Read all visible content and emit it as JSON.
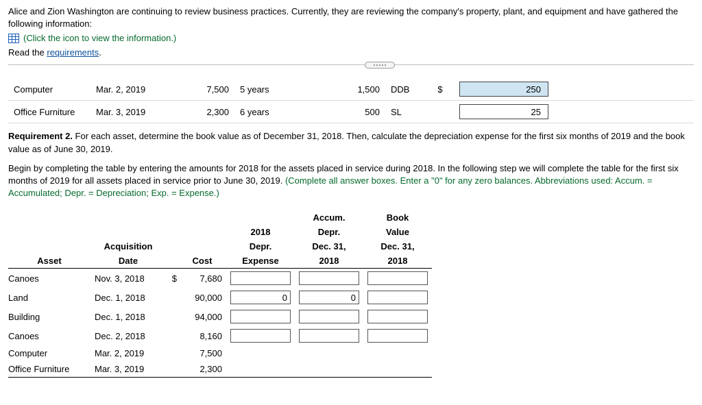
{
  "intro": "Alice and Zion Washington are continuing to review business practices. Currently, they are reviewing the company's property, plant, and equipment and have gathered the following information:",
  "infoLink": "(Click the icon to view the information.)",
  "readReq": {
    "prefix": "Read the ",
    "link": "requirements",
    "suffix": "."
  },
  "upperRows": [
    {
      "asset": "Computer",
      "date": "Mar. 2, 2019",
      "cost": "7,500",
      "life": "5 years",
      "residual": "1,500",
      "method": "DDB",
      "dollar": "$",
      "expense": "250",
      "highlight": true
    },
    {
      "asset": "Office Furniture",
      "date": "Mar. 3, 2019",
      "cost": "2,300",
      "life": "6 years",
      "residual": "500",
      "method": "SL",
      "dollar": "",
      "expense": "25",
      "highlight": false
    }
  ],
  "req2": {
    "label": "Requirement 2.",
    "text": " For each asset, determine the book value as of December 31, 2018. Then, calculate the depreciation expense for the first six months of 2019 and the book value as of June 30, 2019."
  },
  "instr": {
    "text": "Begin by completing the table by entering the amounts for 2018 for the assets placed in service during 2018. In the following step we will complete the table for the first six months of 2019 for all assets placed in service prior to June 30, 2019. ",
    "paren": "(Complete all answer boxes. Enter a \"0\" for any zero balances. Abbreviations used: Accum. = Accumulated; Depr. = Depreciation; Exp. = Expense.)"
  },
  "bvHeaders": {
    "asset": "Asset",
    "acqDate1": "Acquisition",
    "acqDate2": "Date",
    "cost": "Cost",
    "depr1": "2018",
    "depr2": "Depr.",
    "depr3": "Expense",
    "accum1": "Accum.",
    "accum2": "Depr.",
    "accum3": "Dec. 31,",
    "accum4": "2018",
    "book1": "Book",
    "book2": "Value",
    "book3": "Dec. 31,",
    "book4": "2018"
  },
  "bvRows": [
    {
      "asset": "Canoes",
      "date": "Nov. 3, 2018",
      "dollar": "$",
      "cost": "7,680",
      "showInputs": true,
      "depr": "",
      "accum": "",
      "book": ""
    },
    {
      "asset": "Land",
      "date": "Dec. 1, 2018",
      "dollar": "",
      "cost": "90,000",
      "showInputs": true,
      "depr": "0",
      "accum": "0",
      "book": ""
    },
    {
      "asset": "Building",
      "date": "Dec. 1, 2018",
      "dollar": "",
      "cost": "94,000",
      "showInputs": true,
      "depr": "",
      "accum": "",
      "book": ""
    },
    {
      "asset": "Canoes",
      "date": "Dec. 2, 2018",
      "dollar": "",
      "cost": "8,160",
      "showInputs": true,
      "depr": "",
      "accum": "",
      "book": ""
    },
    {
      "asset": "Computer",
      "date": "Mar. 2, 2019",
      "dollar": "",
      "cost": "7,500",
      "showInputs": false
    },
    {
      "asset": "Office Furniture",
      "date": "Mar. 3, 2019",
      "dollar": "",
      "cost": "2,300",
      "showInputs": false
    }
  ]
}
